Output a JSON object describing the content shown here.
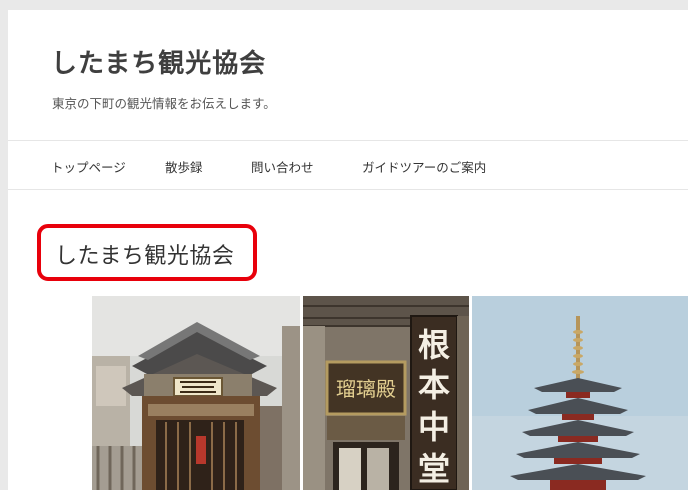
{
  "site": {
    "title": "したまち観光協会",
    "description": "東京の下町の観光情報をお伝えします。"
  },
  "nav": {
    "items": [
      {
        "label": "トップページ"
      },
      {
        "label": "散歩録"
      },
      {
        "label": "問い合わせ"
      },
      {
        "label": "ガイドツアーのご案内"
      }
    ]
  },
  "entry": {
    "title": "したまち観光協会",
    "highlight_color": "#e8000b"
  },
  "photos": {
    "signboard_text": "根本中堂",
    "plaque_text": "瑠璃殿"
  },
  "colors": {
    "page_background": "#ffffff",
    "outer_background": "#e9e9e9",
    "text": "#333333"
  }
}
